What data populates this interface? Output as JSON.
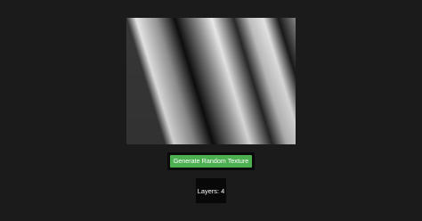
{
  "app": {
    "background": "#1b1b1b"
  },
  "texture": {
    "description_colors": [
      "#000000",
      "#ffffff"
    ],
    "layers": 4
  },
  "controls": {
    "generate_label": "Generate Random Texture",
    "button_color": "#4caf50",
    "layers_label": "Layers: 4"
  }
}
